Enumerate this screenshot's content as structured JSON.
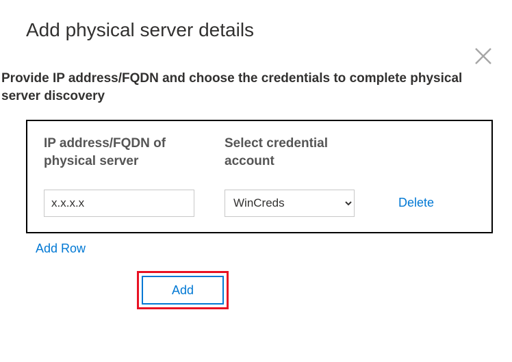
{
  "title": "Add physical server details",
  "description": "Provide IP address/FQDN and choose the credentials to complete physical server discovery",
  "table": {
    "headers": {
      "ip": "IP address/FQDN of physical server",
      "cred": "Select credential account"
    },
    "rows": [
      {
        "ip_value": "x.x.x.x",
        "cred_value": "WinCreds",
        "delete_label": "Delete"
      }
    ]
  },
  "actions": {
    "add_row": "Add Row",
    "add": "Add"
  }
}
